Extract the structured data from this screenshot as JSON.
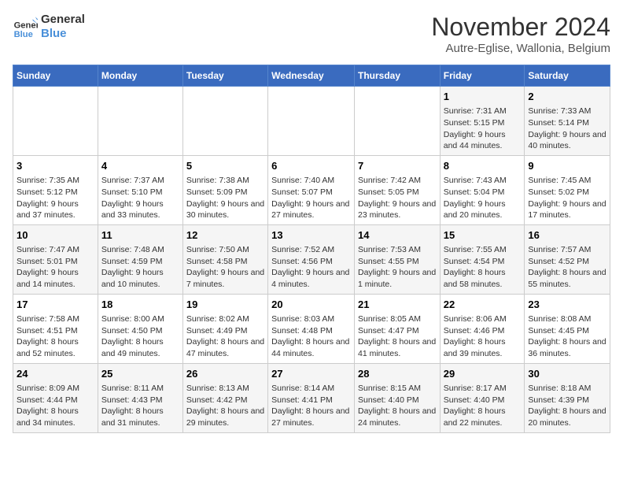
{
  "logo": {
    "line1": "General",
    "line2": "Blue"
  },
  "title": "November 2024",
  "location": "Autre-Eglise, Wallonia, Belgium",
  "weekdays": [
    "Sunday",
    "Monday",
    "Tuesday",
    "Wednesday",
    "Thursday",
    "Friday",
    "Saturday"
  ],
  "weeks": [
    [
      {
        "day": "",
        "info": ""
      },
      {
        "day": "",
        "info": ""
      },
      {
        "day": "",
        "info": ""
      },
      {
        "day": "",
        "info": ""
      },
      {
        "day": "",
        "info": ""
      },
      {
        "day": "1",
        "info": "Sunrise: 7:31 AM\nSunset: 5:15 PM\nDaylight: 9 hours and 44 minutes."
      },
      {
        "day": "2",
        "info": "Sunrise: 7:33 AM\nSunset: 5:14 PM\nDaylight: 9 hours and 40 minutes."
      }
    ],
    [
      {
        "day": "3",
        "info": "Sunrise: 7:35 AM\nSunset: 5:12 PM\nDaylight: 9 hours and 37 minutes."
      },
      {
        "day": "4",
        "info": "Sunrise: 7:37 AM\nSunset: 5:10 PM\nDaylight: 9 hours and 33 minutes."
      },
      {
        "day": "5",
        "info": "Sunrise: 7:38 AM\nSunset: 5:09 PM\nDaylight: 9 hours and 30 minutes."
      },
      {
        "day": "6",
        "info": "Sunrise: 7:40 AM\nSunset: 5:07 PM\nDaylight: 9 hours and 27 minutes."
      },
      {
        "day": "7",
        "info": "Sunrise: 7:42 AM\nSunset: 5:05 PM\nDaylight: 9 hours and 23 minutes."
      },
      {
        "day": "8",
        "info": "Sunrise: 7:43 AM\nSunset: 5:04 PM\nDaylight: 9 hours and 20 minutes."
      },
      {
        "day": "9",
        "info": "Sunrise: 7:45 AM\nSunset: 5:02 PM\nDaylight: 9 hours and 17 minutes."
      }
    ],
    [
      {
        "day": "10",
        "info": "Sunrise: 7:47 AM\nSunset: 5:01 PM\nDaylight: 9 hours and 14 minutes."
      },
      {
        "day": "11",
        "info": "Sunrise: 7:48 AM\nSunset: 4:59 PM\nDaylight: 9 hours and 10 minutes."
      },
      {
        "day": "12",
        "info": "Sunrise: 7:50 AM\nSunset: 4:58 PM\nDaylight: 9 hours and 7 minutes."
      },
      {
        "day": "13",
        "info": "Sunrise: 7:52 AM\nSunset: 4:56 PM\nDaylight: 9 hours and 4 minutes."
      },
      {
        "day": "14",
        "info": "Sunrise: 7:53 AM\nSunset: 4:55 PM\nDaylight: 9 hours and 1 minute."
      },
      {
        "day": "15",
        "info": "Sunrise: 7:55 AM\nSunset: 4:54 PM\nDaylight: 8 hours and 58 minutes."
      },
      {
        "day": "16",
        "info": "Sunrise: 7:57 AM\nSunset: 4:52 PM\nDaylight: 8 hours and 55 minutes."
      }
    ],
    [
      {
        "day": "17",
        "info": "Sunrise: 7:58 AM\nSunset: 4:51 PM\nDaylight: 8 hours and 52 minutes."
      },
      {
        "day": "18",
        "info": "Sunrise: 8:00 AM\nSunset: 4:50 PM\nDaylight: 8 hours and 49 minutes."
      },
      {
        "day": "19",
        "info": "Sunrise: 8:02 AM\nSunset: 4:49 PM\nDaylight: 8 hours and 47 minutes."
      },
      {
        "day": "20",
        "info": "Sunrise: 8:03 AM\nSunset: 4:48 PM\nDaylight: 8 hours and 44 minutes."
      },
      {
        "day": "21",
        "info": "Sunrise: 8:05 AM\nSunset: 4:47 PM\nDaylight: 8 hours and 41 minutes."
      },
      {
        "day": "22",
        "info": "Sunrise: 8:06 AM\nSunset: 4:46 PM\nDaylight: 8 hours and 39 minutes."
      },
      {
        "day": "23",
        "info": "Sunrise: 8:08 AM\nSunset: 4:45 PM\nDaylight: 8 hours and 36 minutes."
      }
    ],
    [
      {
        "day": "24",
        "info": "Sunrise: 8:09 AM\nSunset: 4:44 PM\nDaylight: 8 hours and 34 minutes."
      },
      {
        "day": "25",
        "info": "Sunrise: 8:11 AM\nSunset: 4:43 PM\nDaylight: 8 hours and 31 minutes."
      },
      {
        "day": "26",
        "info": "Sunrise: 8:13 AM\nSunset: 4:42 PM\nDaylight: 8 hours and 29 minutes."
      },
      {
        "day": "27",
        "info": "Sunrise: 8:14 AM\nSunset: 4:41 PM\nDaylight: 8 hours and 27 minutes."
      },
      {
        "day": "28",
        "info": "Sunrise: 8:15 AM\nSunset: 4:40 PM\nDaylight: 8 hours and 24 minutes."
      },
      {
        "day": "29",
        "info": "Sunrise: 8:17 AM\nSunset: 4:40 PM\nDaylight: 8 hours and 22 minutes."
      },
      {
        "day": "30",
        "info": "Sunrise: 8:18 AM\nSunset: 4:39 PM\nDaylight: 8 hours and 20 minutes."
      }
    ]
  ]
}
